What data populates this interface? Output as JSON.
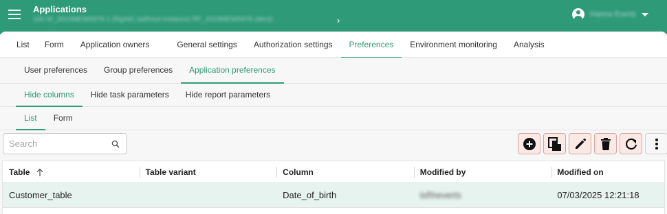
{
  "header": {
    "title": "Applications",
    "subtitle": "100 W_2023MEW5976-1 (Rg4d1 (without instance) RF_2023MEW5976 (dev))",
    "user_name": "Hanna Everts"
  },
  "main_tabs": [
    "List",
    "Form",
    "Application owners",
    "General settings",
    "Authorization settings",
    "Preferences",
    "Environment monitoring",
    "Analysis"
  ],
  "pref_tabs": [
    "User preferences",
    "Group preferences",
    "Application preferences"
  ],
  "hide_tabs": [
    "Hide columns",
    "Hide task parameters",
    "Hide report parameters"
  ],
  "view_tabs": [
    "List",
    "Form"
  ],
  "search": {
    "placeholder": "Search"
  },
  "actions": [
    "add-icon",
    "copy-icon",
    "edit-icon",
    "delete-icon",
    "refresh-icon",
    "more-vertical-icon"
  ],
  "table": {
    "columns": [
      "Table",
      "Table variant",
      "Column",
      "Modified by",
      "Modified on"
    ],
    "rows": [
      {
        "table": "Customer_table",
        "variant": "",
        "column": "Date_of_birth",
        "modified_by": "tsf\\heverts",
        "modified_on": "07/03/2025 12:21:18"
      }
    ]
  },
  "colors": {
    "accent": "#2e9a78",
    "selected_row": "#e6f3ef",
    "action_bg": "#fbe9e6",
    "action_border": "#d8a29a"
  }
}
